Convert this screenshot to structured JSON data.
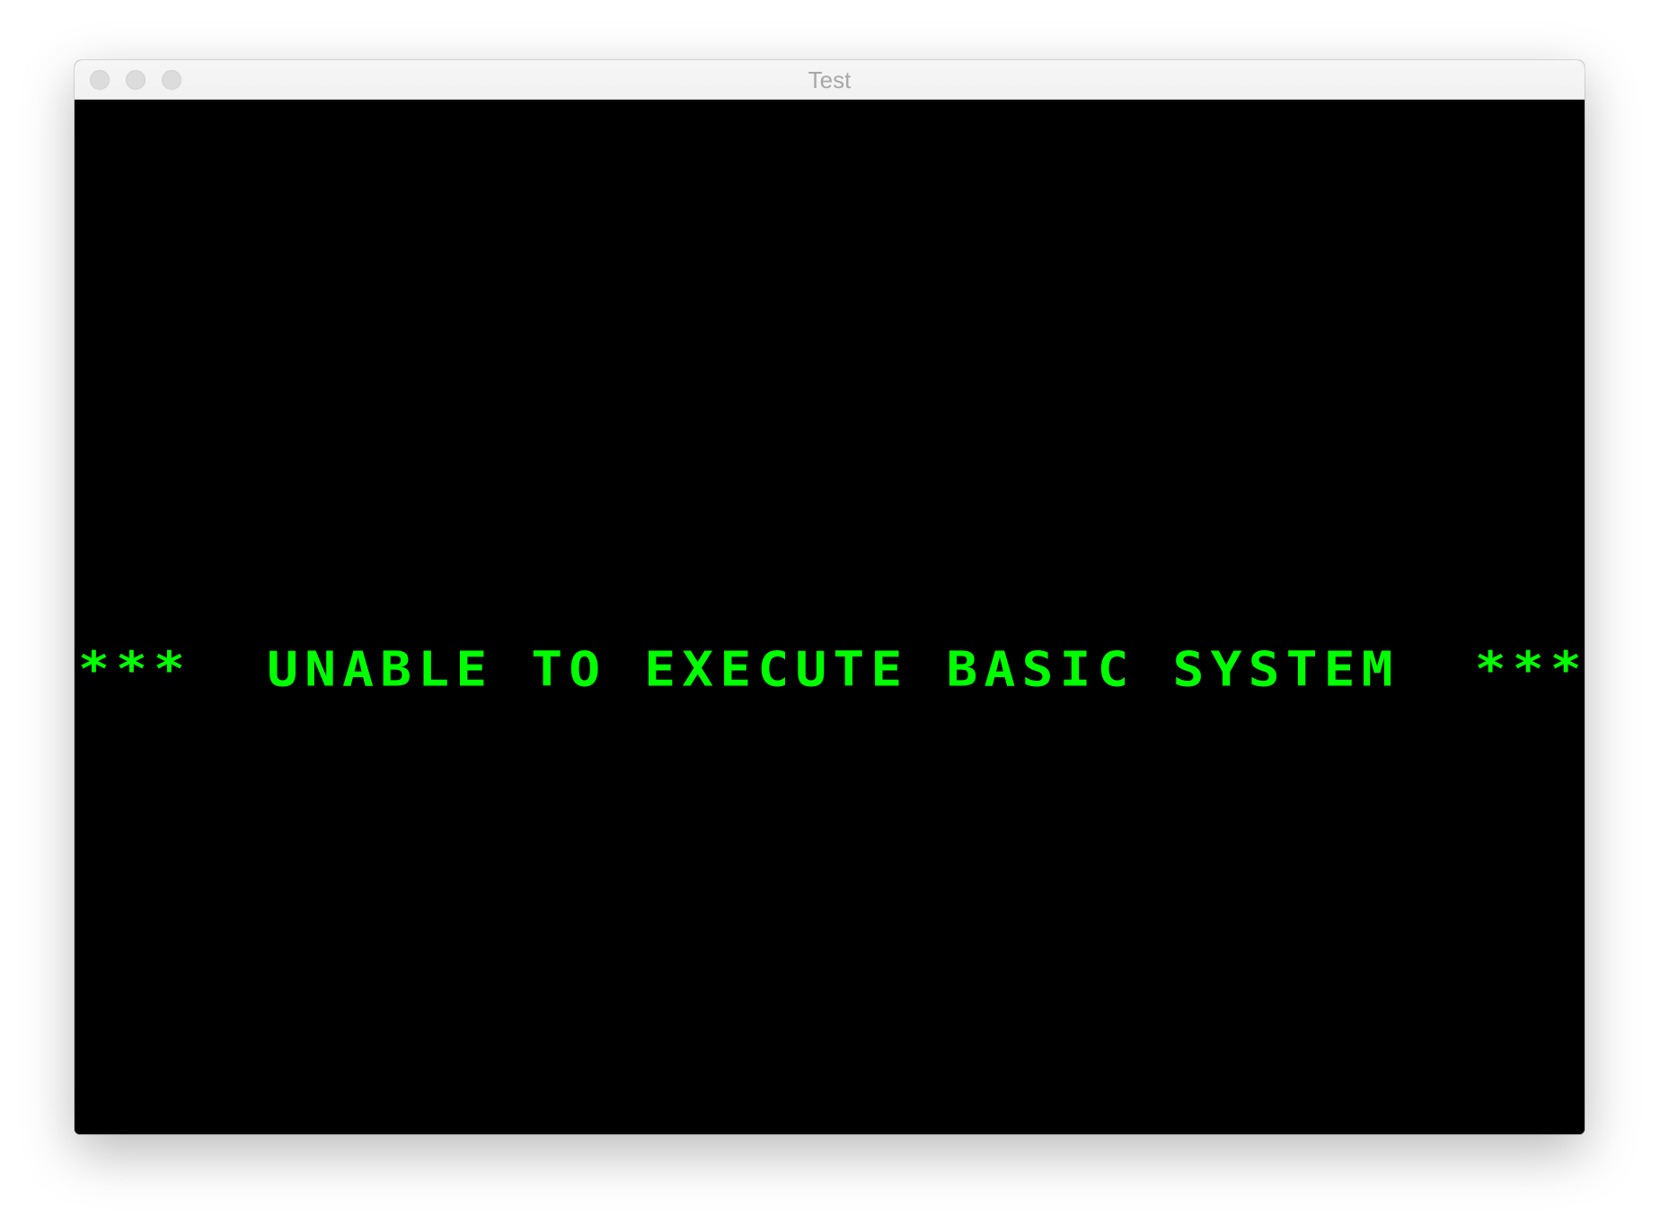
{
  "window": {
    "title": "Test",
    "controls": {
      "close": "close-button",
      "minimize": "minimize-button",
      "zoom": "zoom-button"
    }
  },
  "screen": {
    "background_color": "#000000",
    "text_color": "#00ff00",
    "columns": 40,
    "lines": [
      "***  UNABLE TO EXECUTE BASIC SYSTEM  ***"
    ]
  }
}
